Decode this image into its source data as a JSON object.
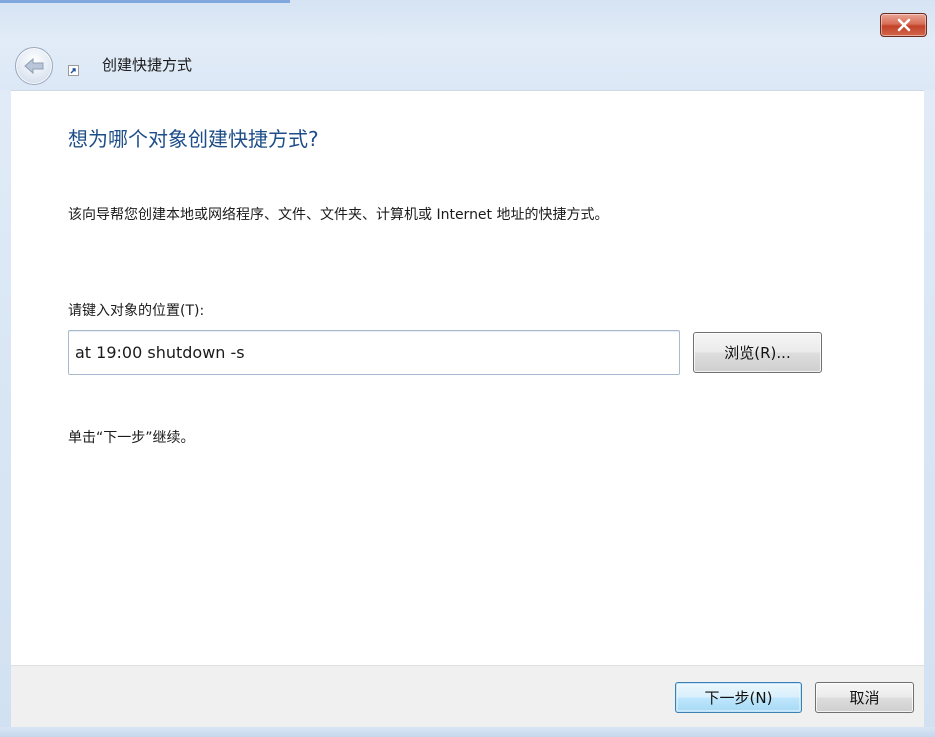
{
  "window": {
    "title": "创建快捷方式",
    "close_icon": "close-icon",
    "back_icon": "back-arrow-icon",
    "shortcut_icon": "shortcut-icon"
  },
  "page": {
    "heading": "想为哪个对象创建快捷方式?",
    "description": "该向导帮您创建本地或网络程序、文件、文件夹、计算机或 Internet 地址的快捷方式。",
    "location_label": "请键入对象的位置(T):",
    "location_value": "at 19:00 shutdown -s",
    "browse_label": "浏览(R)...",
    "hint": "单击“下一步”继续。"
  },
  "footer": {
    "next_label": "下一步(N)",
    "cancel_label": "取消"
  },
  "colors": {
    "heading": "#1d4e89",
    "close_button": "#c2432a",
    "next_button_border": "#3c7fb1"
  }
}
